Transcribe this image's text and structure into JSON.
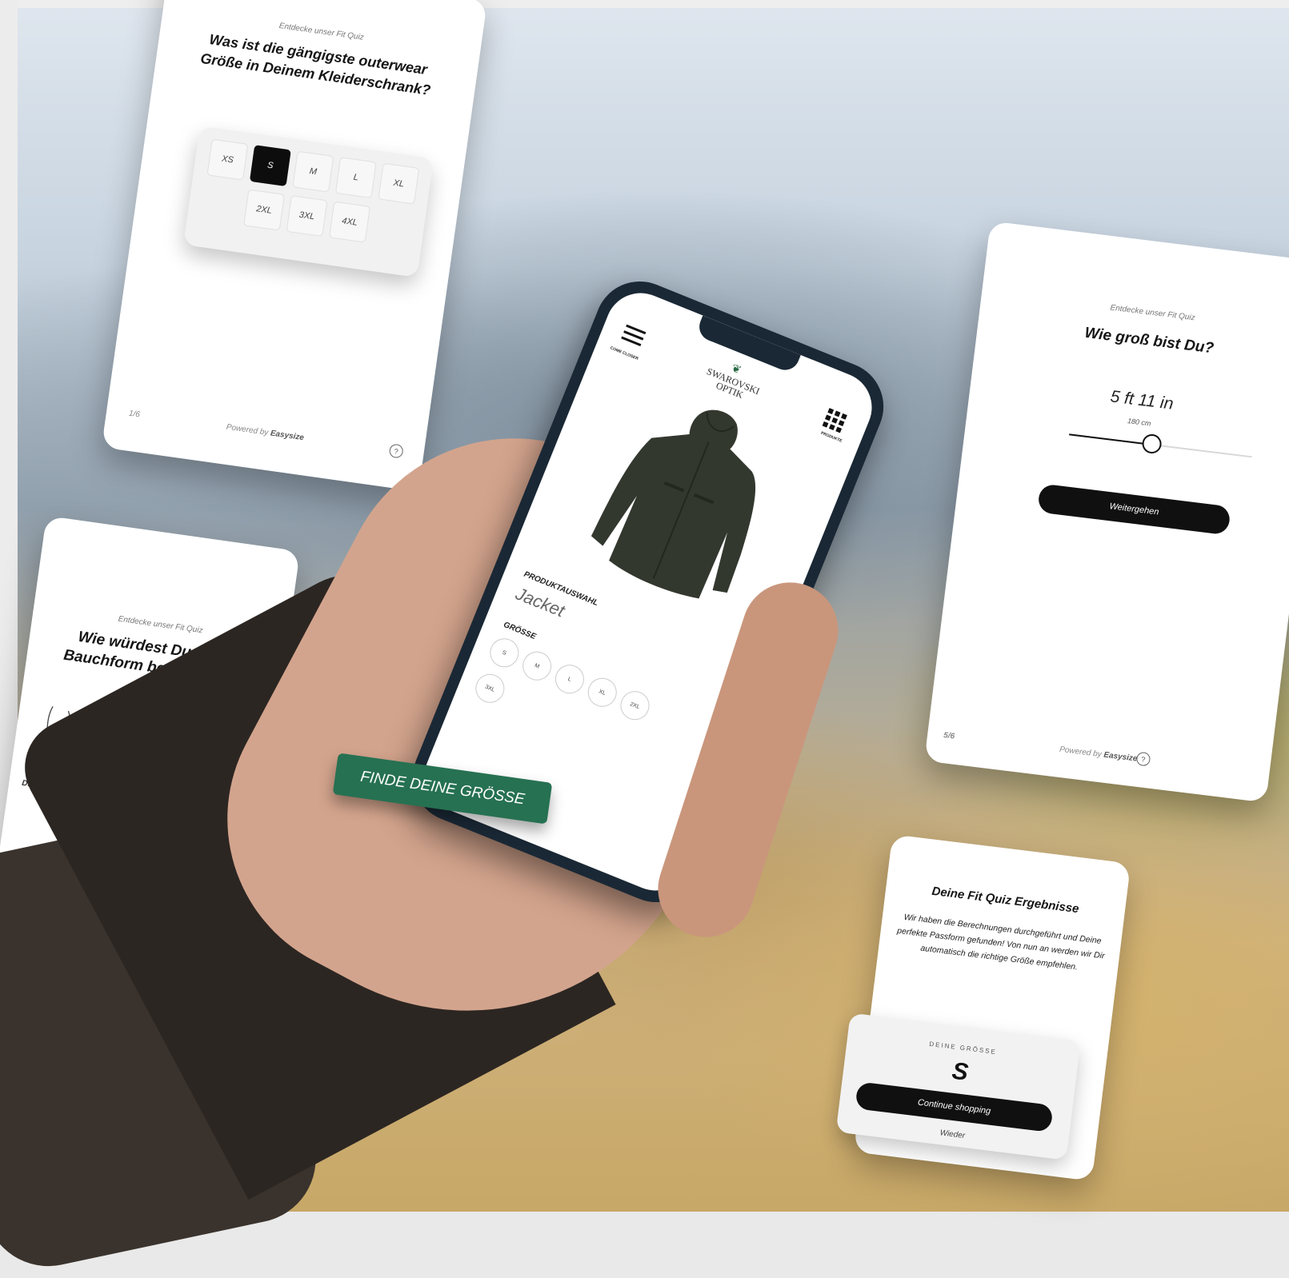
{
  "colors": {
    "accent_green": "#267152",
    "dark_button": "#101010",
    "selected_chip": "#0d0d0d"
  },
  "quiz_size_card": {
    "eyebrow": "Entdecke unser Fit Quiz",
    "question": "Was ist die gängigste outerwear Größe in Deinem Kleiderschrank?",
    "sizes": [
      "XS",
      "S",
      "M",
      "L",
      "XL",
      "2XL",
      "3XL",
      "4XL"
    ],
    "selected": "S",
    "step": "1/6",
    "powered_prefix": "Powered by",
    "powered_brand": "Easysize",
    "help_icon": "?"
  },
  "quiz_belly_card": {
    "eyebrow": "Entdecke unser Fit Quiz",
    "question": "Wie würdest Du Deine Bauchform beschreiben?",
    "option_label": "Durchsch"
  },
  "quiz_height_card": {
    "eyebrow": "Entdecke unser Fit Quiz",
    "question": "Wie groß bist Du?",
    "height_imperial": "5 ft 11 in",
    "height_metric": "180 cm",
    "slider_fraction": 0.45,
    "continue_label": "Weitergehen",
    "step": "5/6",
    "powered_prefix": "Powered by",
    "powered_brand": "Easysize",
    "help_icon": "?"
  },
  "result_card": {
    "title": "Deine Fit Quiz Ergebnisse",
    "text": "Wir haben die Berechnungen durchgeführt und Deine perfekte Passform gefunden! Von nun an werden wir Dir automatisch die richtige Größe empfehlen.",
    "size_label": "DEINE GRÖSSE",
    "size_value": "S",
    "continue_label": "Continue shopping",
    "again_label": "Wieder"
  },
  "phone": {
    "menu_label": "COME CLOSER",
    "brand_line1": "SWAROVSKI",
    "brand_line2": "OPTIK",
    "products_label": "PRODUKTE",
    "product_label": "PRODUKTAUSWAHL",
    "product_name": "Jacket",
    "size_title": "GRÖSSE",
    "sizes": [
      "S",
      "M",
      "L",
      "XL",
      "2XL",
      "3XL"
    ]
  },
  "cta": {
    "label": "FINDE DEINE GRÖSSE"
  }
}
